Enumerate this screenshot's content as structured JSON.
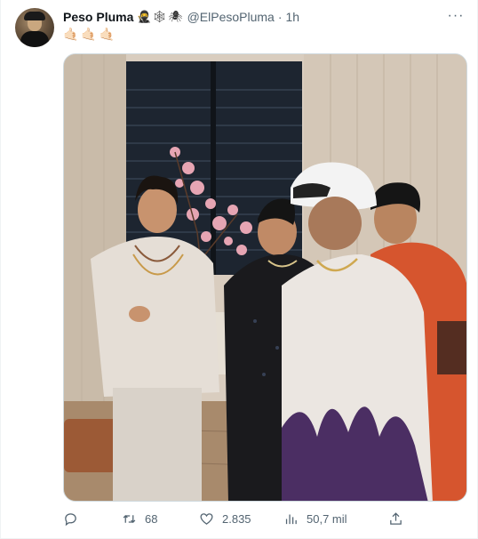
{
  "tweet": {
    "author": {
      "name": "Peso Pluma",
      "name_emojis": "🥷🕸🕷",
      "handle": "@ElPesoPluma",
      "time": "1h"
    },
    "text": "🤙🏻🤙🏻🤙🏻",
    "more_label": "···",
    "media": {
      "type": "photo"
    },
    "actions": {
      "reply": {
        "icon": "reply-icon",
        "count": ""
      },
      "retweet": {
        "icon": "retweet-icon",
        "count": "68"
      },
      "like": {
        "icon": "heart-icon",
        "count": "2.835"
      },
      "views": {
        "icon": "views-icon",
        "count": "50,7 mil"
      },
      "share": {
        "icon": "share-icon"
      }
    }
  },
  "colors": {
    "text_primary": "#0f1419",
    "text_secondary": "#536471",
    "border": "#cfd9de"
  }
}
